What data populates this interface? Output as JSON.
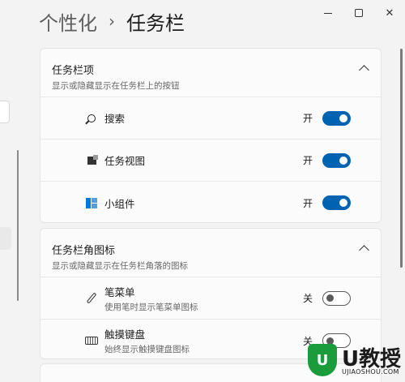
{
  "breadcrumb": {
    "parent": "个性化",
    "separator": "›",
    "current": "任务栏"
  },
  "window_controls": {
    "close": "✕"
  },
  "taskbar_items": {
    "title": "任务栏项",
    "subtitle": "显示或隐藏显示在任务栏上的按钮",
    "items": [
      {
        "icon": "search-icon",
        "label": "搜索",
        "state": "开",
        "on": true
      },
      {
        "icon": "task-view-icon",
        "label": "任务视图",
        "state": "开",
        "on": true
      },
      {
        "icon": "widgets-icon",
        "label": "小组件",
        "state": "开",
        "on": true
      }
    ]
  },
  "corner_icons": {
    "title": "任务栏角图标",
    "subtitle": "显示或隐藏显示在任务栏角落的图标",
    "items": [
      {
        "icon": "pen-icon",
        "label": "笔菜单",
        "desc": "使用笔时显示笔菜单图标",
        "state": "关",
        "on": false
      },
      {
        "icon": "keyboard-icon",
        "label": "触摸键盘",
        "desc": "始终显示触摸键盘图标",
        "state": "关",
        "on": false
      }
    ]
  },
  "watermark": {
    "logo_text": "U",
    "brand": "U教授",
    "url": "UJIAOSHOU.COM"
  },
  "colors": {
    "accent": "#0063b1",
    "background": "#f3f3f3",
    "card": "#fbfbfb"
  }
}
